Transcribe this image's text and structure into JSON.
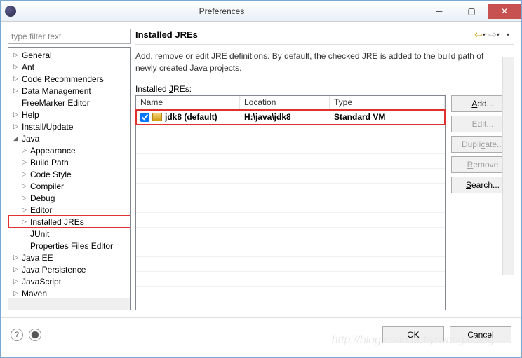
{
  "window": {
    "title": "Preferences"
  },
  "filter": {
    "placeholder": "type filter text"
  },
  "tree": [
    {
      "label": "General",
      "level": 0,
      "twisty": "▷"
    },
    {
      "label": "Ant",
      "level": 0,
      "twisty": "▷"
    },
    {
      "label": "Code Recommenders",
      "level": 0,
      "twisty": "▷"
    },
    {
      "label": "Data Management",
      "level": 0,
      "twisty": "▷"
    },
    {
      "label": "FreeMarker Editor",
      "level": 0,
      "twisty": ""
    },
    {
      "label": "Help",
      "level": 0,
      "twisty": "▷"
    },
    {
      "label": "Install/Update",
      "level": 0,
      "twisty": "▷"
    },
    {
      "label": "Java",
      "level": 0,
      "twisty": "◢"
    },
    {
      "label": "Appearance",
      "level": 1,
      "twisty": "▷"
    },
    {
      "label": "Build Path",
      "level": 1,
      "twisty": "▷"
    },
    {
      "label": "Code Style",
      "level": 1,
      "twisty": "▷"
    },
    {
      "label": "Compiler",
      "level": 1,
      "twisty": "▷"
    },
    {
      "label": "Debug",
      "level": 1,
      "twisty": "▷"
    },
    {
      "label": "Editor",
      "level": 1,
      "twisty": "▷"
    },
    {
      "label": "Installed JREs",
      "level": 1,
      "twisty": "▷",
      "highlighted": true
    },
    {
      "label": "JUnit",
      "level": 1,
      "twisty": ""
    },
    {
      "label": "Properties Files Editor",
      "level": 1,
      "twisty": ""
    },
    {
      "label": "Java EE",
      "level": 0,
      "twisty": "▷"
    },
    {
      "label": "Java Persistence",
      "level": 0,
      "twisty": "▷"
    },
    {
      "label": "JavaScript",
      "level": 0,
      "twisty": "▷"
    },
    {
      "label": "Maven",
      "level": 0,
      "twisty": "▷"
    }
  ],
  "page": {
    "title": "Installed JREs",
    "description": "Add, remove or edit JRE definitions. By default, the checked JRE is added to the build path of newly created Java projects.",
    "section_label_pre": "Installed ",
    "section_label_ul": "J",
    "section_label_post": "REs:"
  },
  "table": {
    "headers": {
      "name": "Name",
      "location": "Location",
      "type": "Type"
    },
    "rows": [
      {
        "checked": true,
        "name": "jdk8 (default)",
        "location": "H:\\java\\jdk8",
        "type": "Standard VM"
      }
    ]
  },
  "buttons": {
    "add_ul": "A",
    "add_post": "dd...",
    "edit_ul": "E",
    "edit_post": "dit...",
    "dup_pre": "Dupli",
    "dup_ul": "c",
    "dup_post": "ate...",
    "remove_ul": "R",
    "remove_post": "emove",
    "search_ul": "S",
    "search_post": "earch..."
  },
  "footer": {
    "ok": "OK",
    "cancel": "Cancel"
  },
  "watermark": "http://blog.csdn.net/yiwangxiblog"
}
